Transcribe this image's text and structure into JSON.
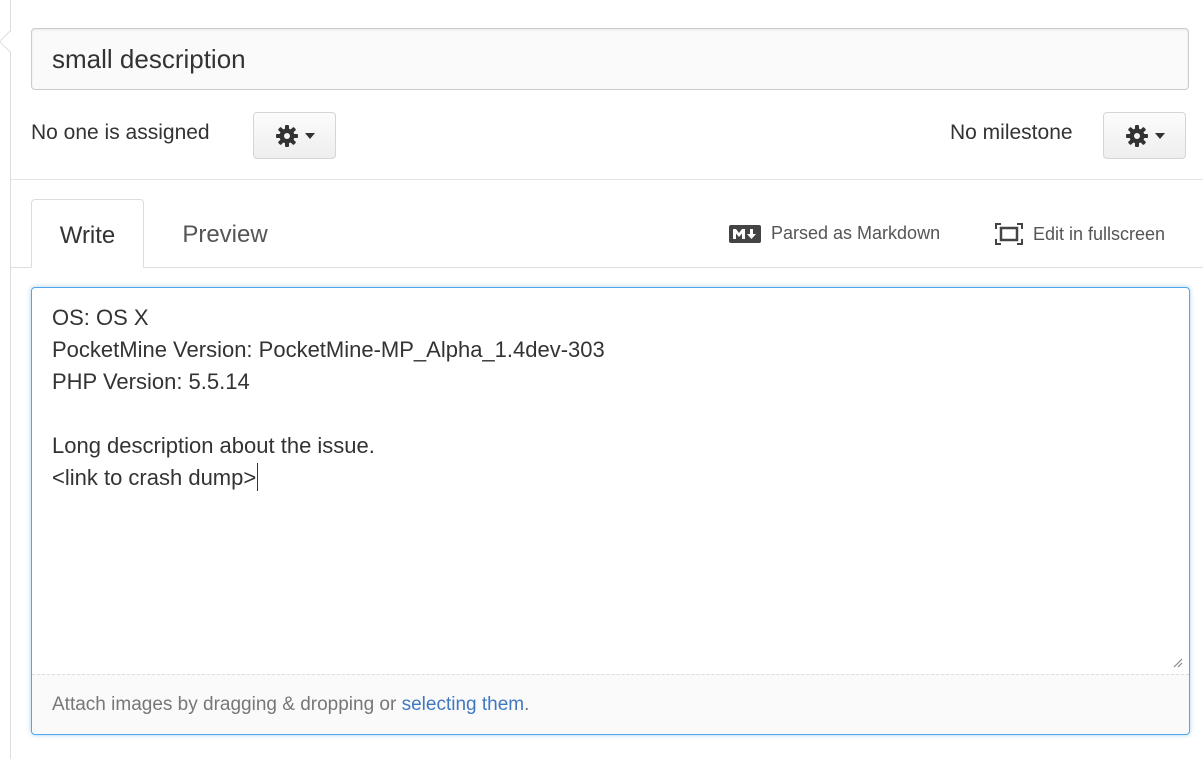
{
  "title_field": {
    "value": "small description"
  },
  "assignee": {
    "text": "No one is assigned"
  },
  "milestone": {
    "text": "No milestone"
  },
  "tabs": [
    {
      "label": "Write",
      "active": true
    },
    {
      "label": "Preview",
      "active": false
    }
  ],
  "toolbar": {
    "markdown_label": "Parsed as Markdown",
    "fullscreen_label": "Edit in fullscreen"
  },
  "editor": {
    "lines": [
      "OS: OS X",
      "PocketMine Version: PocketMine-MP_Alpha_1.4dev-303",
      "PHP Version: 5.5.14",
      "",
      "Long description about the issue.",
      "<link to crash dump>"
    ]
  },
  "attach": {
    "prefix": "Attach images by dragging & dropping or ",
    "link": "selecting them",
    "suffix": "."
  },
  "icons": {
    "assignee_gear": "gear-icon",
    "milestone_gear": "gear-icon",
    "markdown": "markdown-icon",
    "fullscreen": "fullscreen-icon"
  },
  "colors": {
    "link": "#4078c0",
    "focus": "#51a7e8"
  }
}
